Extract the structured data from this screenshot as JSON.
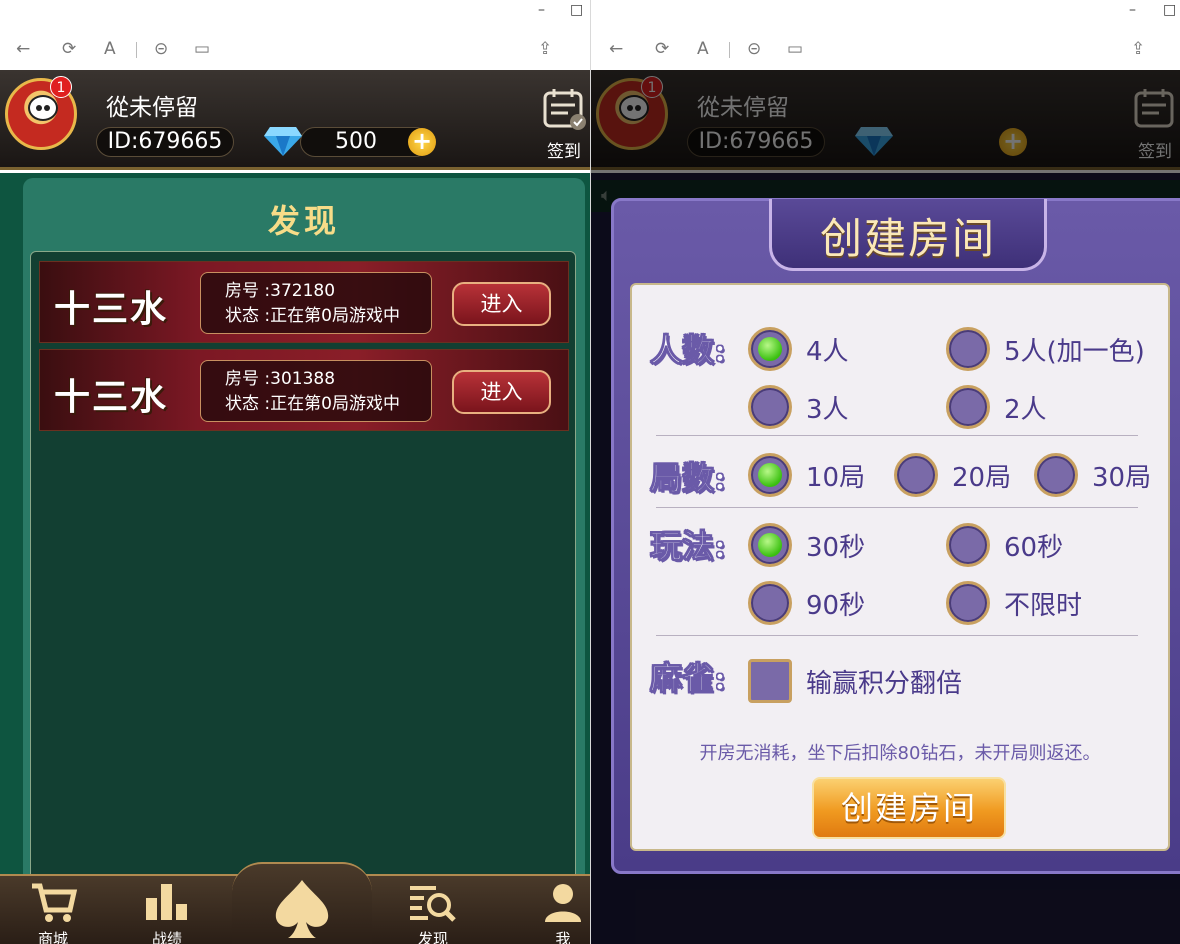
{
  "window": {
    "minimize": "–",
    "maximize": "□"
  },
  "nav": {
    "back": "←",
    "reload": "⟳",
    "reader": "A",
    "link": "⊝",
    "tabs": "▭",
    "share": "⇪"
  },
  "user": {
    "name": "從未停留",
    "id": "ID:679665",
    "diamonds": "500",
    "badge_count": "1",
    "signin_label": "签到"
  },
  "discover": {
    "title": "发现",
    "rooms": [
      {
        "game": "十三水",
        "room": "房号 :372180",
        "status": "状态 :正在第0局游戏中",
        "enter": "进入"
      },
      {
        "game": "十三水",
        "room": "房号 :301388",
        "status": "状态 :正在第0局游戏中",
        "enter": "进入"
      }
    ]
  },
  "tabbar": {
    "items": [
      {
        "label": "商城",
        "icon": "cart-icon"
      },
      {
        "label": "战绩",
        "icon": "bar-chart-icon"
      },
      {
        "label": "",
        "icon": "spade-icon"
      },
      {
        "label": "发现",
        "icon": "discover-search-icon"
      },
      {
        "label": "我",
        "icon": "user-icon"
      }
    ]
  },
  "create_room": {
    "title": "创建房间",
    "players": {
      "label": "人数:",
      "options": [
        "4人",
        "5人(加一色)",
        "3人",
        "2人"
      ],
      "selected": "4人"
    },
    "rounds": {
      "label": "局数:",
      "options": [
        "10局",
        "20局",
        "30局"
      ],
      "selected": "10局"
    },
    "mode": {
      "label": "玩法:",
      "options": [
        "30秒",
        "60秒",
        "90秒",
        "不限时"
      ],
      "selected": "30秒"
    },
    "mahjong": {
      "label": "麻雀:",
      "option": "输赢积分翻倍",
      "checked": false
    },
    "note": "开房无消耗，坐下后扣除80钻石，未开局则返还。",
    "button": "创建房间"
  },
  "colors": {
    "accent_gold": "#f7dc88",
    "green_bg": "#0e5540",
    "purple": "#6a5aa8",
    "enter_red": "#b83238"
  }
}
